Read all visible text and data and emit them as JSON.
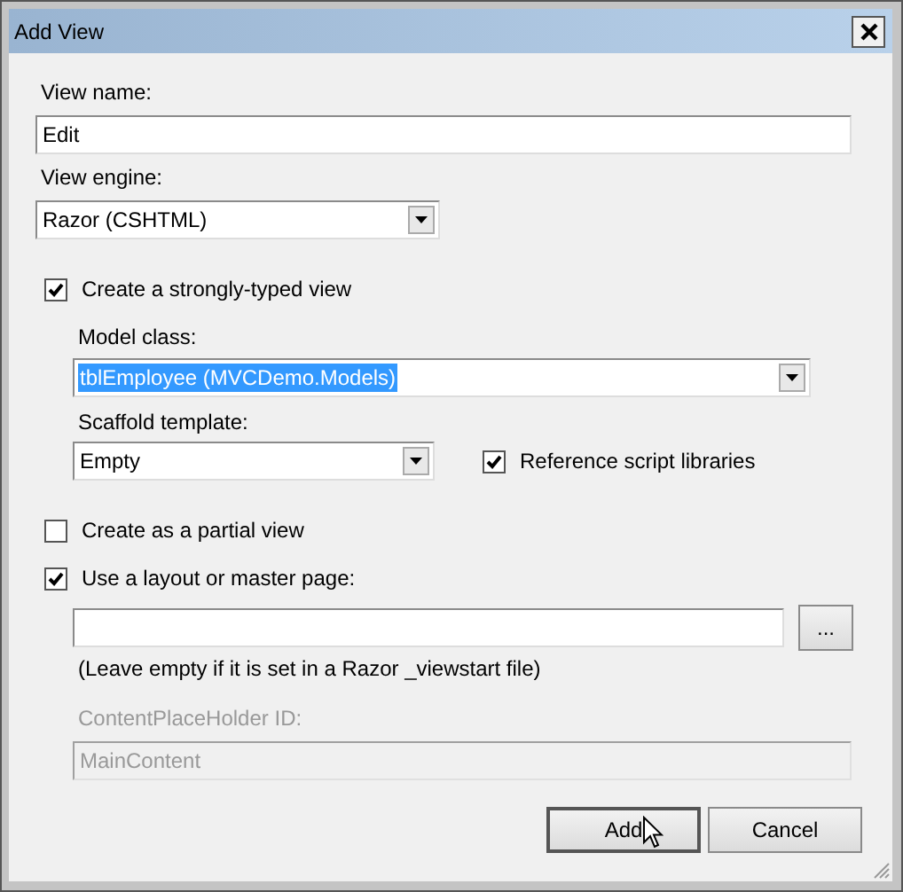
{
  "window": {
    "title": "Add View"
  },
  "view_name": {
    "label": "View name:",
    "value": "Edit"
  },
  "view_engine": {
    "label": "View engine:",
    "value": "Razor (CSHTML)"
  },
  "strongly_typed": {
    "label": "Create a strongly-typed view",
    "checked": true
  },
  "model_class": {
    "label": "Model class:",
    "value": "tblEmployee (MVCDemo.Models)",
    "selected": true
  },
  "scaffold_template": {
    "label": "Scaffold template:",
    "value": "Empty"
  },
  "reference_scripts": {
    "label": "Reference script libraries",
    "checked": true
  },
  "partial_view": {
    "label": "Create as a partial view",
    "checked": false
  },
  "use_layout": {
    "label": "Use a layout or master page:",
    "checked": true
  },
  "layout_browse": {
    "label": "..."
  },
  "layout_hint": "(Leave empty if it is set in a Razor _viewstart file)",
  "content_placeholder": {
    "label": "ContentPlaceHolder ID:",
    "value": "MainContent",
    "disabled": true
  },
  "buttons": [
    {
      "label": "Add",
      "default": true
    },
    {
      "label": "Cancel",
      "default": false
    }
  ]
}
